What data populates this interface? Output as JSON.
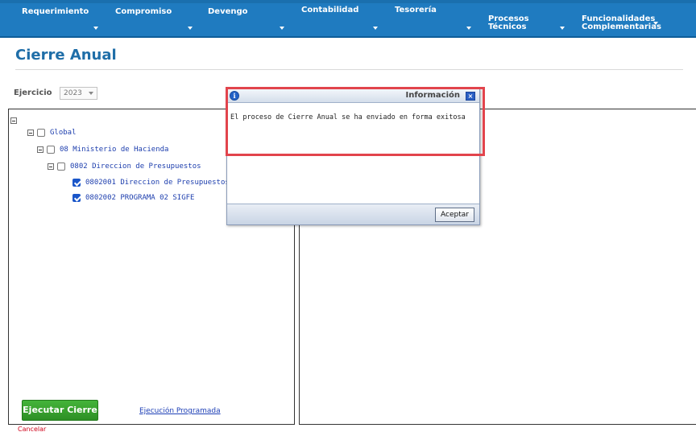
{
  "nav": {
    "items": [
      {
        "label": "Requerimiento",
        "sub": ""
      },
      {
        "label": "Compromiso",
        "sub": ""
      },
      {
        "label": "Devengo",
        "sub": ""
      },
      {
        "label": "Contabilidad",
        "sub": ""
      },
      {
        "label": "Tesorería",
        "sub": ""
      },
      {
        "label": "Procesos",
        "sub": "Técnicos"
      },
      {
        "label": "Funcionalidades",
        "sub": "Complementarias"
      }
    ]
  },
  "page": {
    "title": "Cierre Anual"
  },
  "filter": {
    "ejercicio_label": "Ejercicio",
    "year_value": "2023"
  },
  "tree": {
    "nodes": [
      {
        "label": "Global",
        "checked": false
      },
      {
        "label": "08 Ministerio de Hacienda",
        "checked": false
      },
      {
        "label": "0802 Direccion de Presupuestos",
        "checked": false
      },
      {
        "label": "0802001 Direccion de Presupuestos",
        "checked": true
      },
      {
        "label": "0802002 PROGRAMA 02 SIGFE",
        "checked": true
      }
    ]
  },
  "actions": {
    "ejecutar_label": "Ejecutar Cierre",
    "programada_label": "Ejecución Programada",
    "cancelar_label": "Cancelar"
  },
  "modal": {
    "title": "Información",
    "message": "El proceso de Cierre Anual se ha enviado en forma exitosa",
    "accept_label": "Aceptar",
    "close_glyph": "×"
  },
  "colors": {
    "nav_bg": "#1f7bc0",
    "title_color": "#1f6ea8",
    "success_button": "#3aa330",
    "highlight": "#e2444c",
    "link": "#1d3fb6"
  }
}
